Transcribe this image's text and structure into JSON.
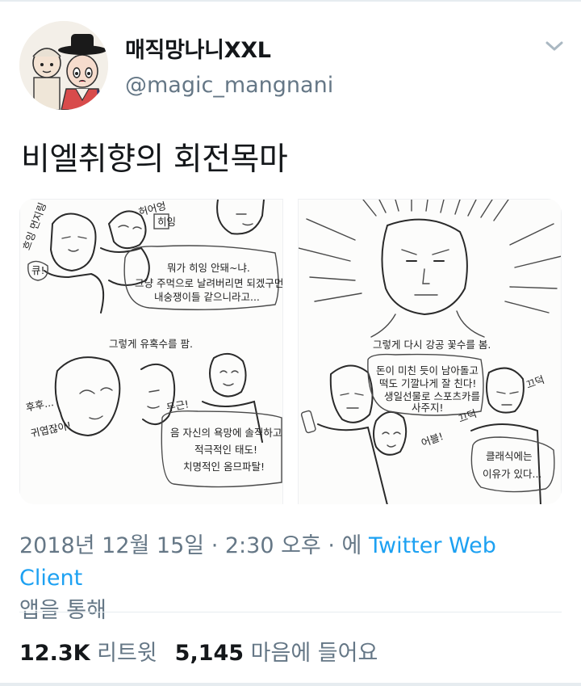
{
  "user": {
    "display_name": "매직망나니XXL",
    "handle": "@magic_mangnani",
    "avatar_icon": "cartoon-avatar-icon"
  },
  "tweet": {
    "text": "비엘취향의 회전목마",
    "menu_icon": "chevron-down-icon"
  },
  "media": {
    "left_panel": {
      "doodle_top": "허어엉",
      "doodle_heen": "히잉",
      "doodle_wimper": "흐잉\n먼지링",
      "doodle_kyu": "큐!",
      "bubble": [
        "뭐가 히잉 안돼~냐.",
        "그냥 주먹으로 날려버리면 되겠구먼.",
        "내숭쟁이들 같으니라고..."
      ],
      "caption": "그렇게 유혹수를 팜.",
      "doodle_giggle": "후후...\n귀엽잖아!",
      "doodle_dugeun": "두근!",
      "bottom_bubble": [
        "음 자신의 욕망에 솔직하고",
        "적극적인 태도!",
        "치명적인 옴므파탈!"
      ]
    },
    "right_panel": {
      "caption": "그렇게 다시 강공 꽃수를 봄.",
      "bubble": [
        "돈이 미친 듯이 남아돌고",
        "떡도 기깔나게 잘 친다!",
        "생일선물로 스포츠카를",
        "사주지!"
      ],
      "doodle_eobeu": "어블!",
      "doodle_ggeudeok1": "끄덕",
      "doodle_ggeudeok2": "끄덕",
      "bottom_bubble": [
        "클래식에는",
        "이유가 있다..."
      ]
    }
  },
  "meta": {
    "date": "2018년 12월 15일",
    "sep": " · ",
    "time": "2:30 오후",
    "via_prefix": "에 ",
    "app": "Twitter Web Client",
    "via_suffix": "앱을 통해"
  },
  "stats": {
    "retweets_count": "12.3K",
    "retweets_label": "리트윗",
    "likes_count": "5,145",
    "likes_label": "마음에 들어요"
  },
  "colors": {
    "text_primary": "#14171a",
    "text_secondary": "#657786",
    "link": "#1da1f2",
    "divider": "#e6ecf0"
  }
}
